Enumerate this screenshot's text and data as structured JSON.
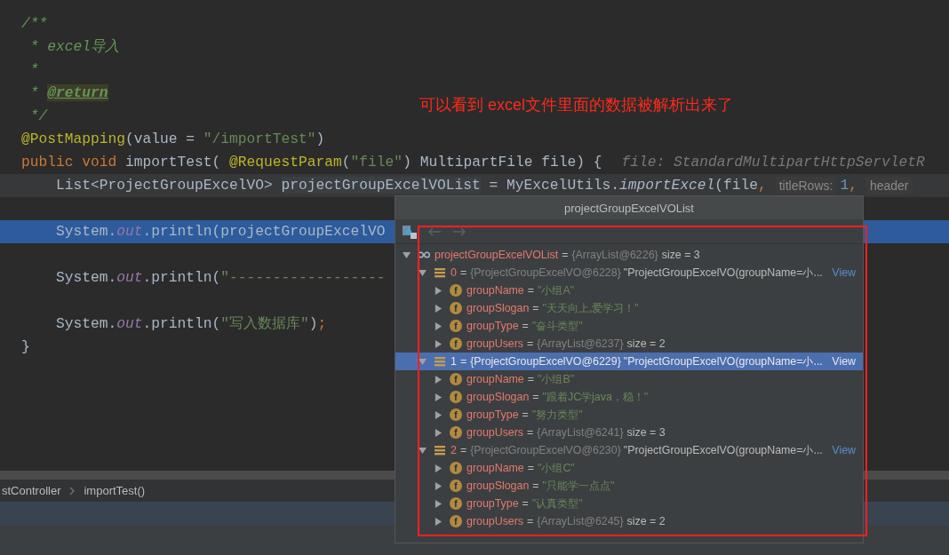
{
  "editor": {
    "lines": [
      {
        "caret": false,
        "current": false,
        "parts": [
          {
            "kind": "comment",
            "text": "/**"
          }
        ]
      },
      {
        "caret": false,
        "current": false,
        "parts": [
          {
            "kind": "comment",
            "text": " * excel导入"
          }
        ]
      },
      {
        "caret": false,
        "current": false,
        "parts": [
          {
            "kind": "comment",
            "text": " *"
          }
        ]
      },
      {
        "caret": false,
        "current": false,
        "parts": [
          {
            "kind": "comment",
            "text": " * "
          },
          {
            "kind": "doctag",
            "text": "@return"
          }
        ]
      },
      {
        "caret": false,
        "current": false,
        "parts": [
          {
            "kind": "comment",
            "text": " */"
          }
        ]
      },
      {
        "caret": false,
        "current": false,
        "parts": [
          {
            "kind": "annotation",
            "text": "@PostMapping"
          },
          {
            "kind": "plain",
            "text": "(value = "
          },
          {
            "kind": "string",
            "text": "\"/importTest\""
          },
          {
            "kind": "plain",
            "text": ")"
          }
        ]
      },
      {
        "caret": false,
        "current": false,
        "parts": [
          {
            "kind": "keyword",
            "text": "public void "
          },
          {
            "kind": "plain",
            "text": "importTest( "
          },
          {
            "kind": "annotation",
            "text": "@RequestParam"
          },
          {
            "kind": "plain",
            "text": "("
          },
          {
            "kind": "string",
            "text": "\"file\""
          },
          {
            "kind": "plain",
            "text": ") MultipartFile file) {"
          },
          {
            "kind": "value_hint",
            "text": "file: StandardMultipartHttpServletR"
          }
        ]
      },
      {
        "caret": true,
        "current": false,
        "parts": [
          {
            "kind": "plain",
            "text": "    List<ProjectGroupExcelVO> "
          },
          {
            "kind": "usage",
            "text": "projectGroupExcelVOList"
          },
          {
            "kind": "plain",
            "text": " = MyExcelUtils."
          },
          {
            "kind": "italic",
            "text": "importExcel"
          },
          {
            "kind": "plain",
            "text": "(file"
          },
          {
            "kind": "punct",
            "text": ","
          },
          {
            "kind": "param_hint",
            "text": "titleRows:"
          },
          {
            "kind": "number",
            "text": "1"
          },
          {
            "kind": "punct",
            "text": ","
          },
          {
            "kind": "param_hint",
            "text": "header"
          }
        ]
      },
      {
        "caret": false,
        "current": false
      },
      {
        "caret": false,
        "current": true,
        "parts": [
          {
            "kind": "plain",
            "text": "    System."
          },
          {
            "kind": "field",
            "text": "out"
          },
          {
            "kind": "plain",
            "text": ".println(projectGroupExcelVO"
          }
        ]
      },
      {
        "caret": false,
        "current": false
      },
      {
        "caret": false,
        "current": false,
        "parts": [
          {
            "kind": "plain",
            "text": "    System."
          },
          {
            "kind": "field",
            "text": "out"
          },
          {
            "kind": "plain",
            "text": ".println("
          },
          {
            "kind": "string",
            "text": "\"------------------"
          }
        ]
      },
      {
        "caret": false,
        "current": false
      },
      {
        "caret": false,
        "current": false,
        "parts": [
          {
            "kind": "plain",
            "text": "    System."
          },
          {
            "kind": "field",
            "text": "out"
          },
          {
            "kind": "plain",
            "text": ".println("
          },
          {
            "kind": "string",
            "text": "\"写入数据库\""
          },
          {
            "kind": "plain",
            "text": ")"
          },
          {
            "kind": "punct",
            "text": ";"
          }
        ]
      },
      {
        "caret": false,
        "current": false,
        "parts": [
          {
            "kind": "plain",
            "text": "}"
          }
        ]
      }
    ]
  },
  "breadcrumb": [
    "stController",
    "importTest()"
  ],
  "annotation": {
    "text": "可以看到 excel文件里面的数据被解析出来了"
  },
  "popup": {
    "title": "projectGroupExcelVOList",
    "tree": [
      {
        "kind": "variable",
        "name": "projectGroupExcelVOList",
        "eq": "=",
        "value": "{ArrayList@6226}",
        "extra": "size = 3",
        "expanded": true,
        "selected": false,
        "children": [
          {
            "kind": "element",
            "name": "0",
            "eq": "=",
            "value": "{ProjectGroupExcelVO@6228}",
            "extra": "\"ProjectGroupExcelVO(groupName=小...",
            "link": "View",
            "expanded": true,
            "selected": false,
            "children": [
              {
                "kind": "field",
                "badge": "f",
                "name": "groupName",
                "eq": "=",
                "value": "\"小组A\"",
                "expanded": false,
                "selected": false
              },
              {
                "kind": "field",
                "badge": "f",
                "name": "groupSlogan",
                "eq": "=",
                "value": "\"天天向上,爱学习！\"",
                "expanded": false,
                "selected": false
              },
              {
                "kind": "field",
                "badge": "f",
                "name": "groupType",
                "eq": "=",
                "value": "\"奋斗类型\"",
                "expanded": false,
                "selected": false
              },
              {
                "kind": "field",
                "badge": "f",
                "name": "groupUsers",
                "eq": "=",
                "value": "{ArrayList@6237}",
                "extra": "size = 2",
                "expanded": false,
                "selected": false
              }
            ]
          },
          {
            "kind": "element",
            "name": "1",
            "eq": "=",
            "value": "{ProjectGroupExcelVO@6229}",
            "extra": "\"ProjectGroupExcelVO(groupName=小...",
            "link": "View",
            "expanded": true,
            "selected": true,
            "children": [
              {
                "kind": "field",
                "badge": "f",
                "name": "groupName",
                "eq": "=",
                "value": "\"小组B\"",
                "expanded": false,
                "selected": false
              },
              {
                "kind": "field",
                "badge": "f",
                "name": "groupSlogan",
                "eq": "=",
                "value": "\"跟着JC学java，稳！\"",
                "expanded": false,
                "selected": false
              },
              {
                "kind": "field",
                "badge": "f",
                "name": "groupType",
                "eq": "=",
                "value": "\"努力类型\"",
                "expanded": false,
                "selected": false
              },
              {
                "kind": "field",
                "badge": "f",
                "name": "groupUsers",
                "eq": "=",
                "value": "{ArrayList@6241}",
                "extra": "size = 3",
                "expanded": false,
                "selected": false
              }
            ]
          },
          {
            "kind": "element",
            "name": "2",
            "eq": "=",
            "value": "{ProjectGroupExcelVO@6230}",
            "extra": "\"ProjectGroupExcelVO(groupName=小...",
            "link": "View",
            "expanded": true,
            "selected": false,
            "children": [
              {
                "kind": "field",
                "badge": "f",
                "name": "groupName",
                "eq": "=",
                "value": "\"小组C\"",
                "expanded": false,
                "selected": false
              },
              {
                "kind": "field",
                "badge": "f",
                "name": "groupSlogan",
                "eq": "=",
                "value": "\"只能学一点点\"",
                "expanded": false,
                "selected": false
              },
              {
                "kind": "field",
                "badge": "f",
                "name": "groupType",
                "eq": "=",
                "value": "\"认真类型\"",
                "expanded": false,
                "selected": false
              },
              {
                "kind": "field",
                "badge": "f",
                "name": "groupUsers",
                "eq": "=",
                "value": "{ArrayList@6245}",
                "extra": "size = 2",
                "expanded": false,
                "selected": false
              }
            ]
          }
        ]
      }
    ]
  }
}
